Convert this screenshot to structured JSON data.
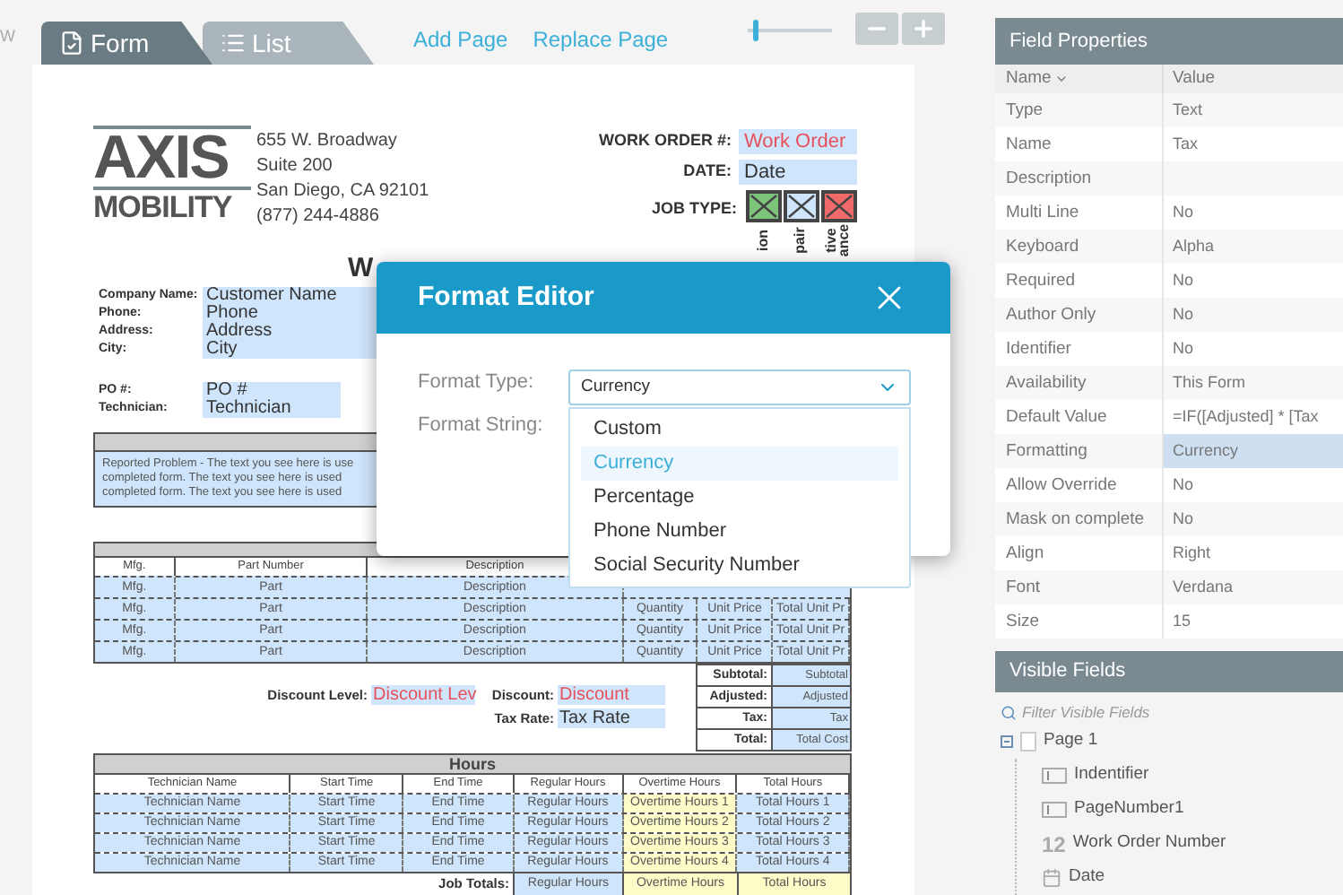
{
  "left_edge_label": "W",
  "tabs": [
    {
      "label": "Form",
      "selected": true
    },
    {
      "label": "List",
      "selected": false
    }
  ],
  "toolbar_links": [
    "Add Page",
    "Replace Page"
  ],
  "zoom": {
    "level": 0.08
  },
  "document": {
    "logo": {
      "top": "AXIS",
      "bottom": "MOBILITY"
    },
    "address": [
      "655 W. Broadway",
      "Suite 200",
      "San Diego, CA 92101",
      "(877) 244-4886"
    ],
    "header_fields": [
      {
        "label": "WORK ORDER #:",
        "value": "Work Order",
        "kind": "accent"
      },
      {
        "label": "DATE:",
        "value": "Date",
        "kind": "plain"
      }
    ],
    "job_type": {
      "label": "JOB TYPE:",
      "options": [
        {
          "checked": true,
          "color": "#7cc57a",
          "caption": [
            "ion"
          ]
        },
        {
          "checked": true,
          "color": "#cfe5fb",
          "caption": [
            "pair"
          ]
        },
        {
          "checked": true,
          "color": "#f06a6a",
          "caption": [
            "tive",
            "ance"
          ]
        }
      ]
    },
    "title": "W",
    "customer_fields": [
      {
        "label": "Company Name:",
        "value": "Customer Name"
      },
      {
        "label": "Phone:",
        "value": "Phone"
      },
      {
        "label": "Address:",
        "value": "Address"
      },
      {
        "label": "City:",
        "value": "City"
      }
    ],
    "po_fields": [
      {
        "label": "PO #:",
        "value": "PO #"
      },
      {
        "label": "Technician:",
        "value": "Technician"
      }
    ],
    "problem": {
      "lines": [
        "Reported Problem - The text you see here is use",
        "completed form. The text you see here is used",
        "completed form. The text you see here is used"
      ]
    },
    "parts": {
      "columns": [
        "Mfg.",
        "Part Number",
        "Description"
      ],
      "rows": [
        [
          "Mfg.",
          "Part",
          "Description"
        ],
        [
          "Mfg.",
          "Part",
          "Description",
          "Quantity",
          "Unit Price",
          "Total Unit Pr"
        ],
        [
          "Mfg.",
          "Part",
          "Description",
          "Quantity",
          "Unit Price",
          "Total Unit Pr"
        ],
        [
          "Mfg.",
          "Part",
          "Description",
          "Quantity",
          "Unit Price",
          "Total Unit Pr"
        ]
      ]
    },
    "discounts": [
      {
        "label": "Discount Level:",
        "value": "Discount Lev",
        "kind": "accent"
      },
      {
        "label": "Discount:",
        "value": "Discount",
        "kind": "accent"
      },
      {
        "label": "Tax Rate:",
        "value": "Tax Rate",
        "kind": "plain"
      }
    ],
    "totals": [
      {
        "label": "Subtotal:",
        "value": "Subtotal"
      },
      {
        "label": "Adjusted:",
        "value": "Adjusted"
      },
      {
        "label": "Tax:",
        "value": "Tax"
      },
      {
        "label": "Total:",
        "value": "Total Cost"
      }
    ],
    "hours": {
      "title": "Hours",
      "columns": [
        "Technician Name",
        "Start Time",
        "End Time",
        "Regular Hours",
        "Overtime Hours",
        "Total Hours"
      ],
      "rows": [
        [
          "Technician Name",
          "Start Time",
          "End Time",
          "Regular Hours",
          "Overtime Hours 1",
          "Total Hours 1"
        ],
        [
          "Technician Name",
          "Start Time",
          "End Time",
          "Regular Hours",
          "Overtime Hours 2",
          "Total Hours 2"
        ],
        [
          "Technician Name",
          "Start Time",
          "End Time",
          "Regular Hours",
          "Overtime Hours 3",
          "Total Hours 3"
        ],
        [
          "Technician Name",
          "Start Time",
          "End Time",
          "Regular Hours",
          "Overtime Hours 4",
          "Total Hours 4"
        ]
      ],
      "totals_label": "Job Totals:",
      "totals": [
        "Regular Hours",
        "Overtime Hours",
        "Total Hours"
      ]
    }
  },
  "dialog": {
    "title": "Format Editor",
    "fields": [
      {
        "label": "Format Type:"
      },
      {
        "label": "Format String:"
      }
    ],
    "select_value": "Currency",
    "options": [
      {
        "label": "Custom",
        "selected": false
      },
      {
        "label": "Currency",
        "selected": true
      },
      {
        "label": "Percentage",
        "selected": false
      },
      {
        "label": "Phone Number",
        "selected": false
      },
      {
        "label": "Social Security Number",
        "selected": false
      }
    ]
  },
  "field_properties": {
    "title": "Field Properties",
    "columns": [
      "Name",
      "Value"
    ],
    "rows": [
      {
        "name": "Type",
        "value": "Text",
        "selected": false
      },
      {
        "name": "Name",
        "value": "Tax",
        "selected": false
      },
      {
        "name": "Description",
        "selected": false
      },
      {
        "name": "Multi Line",
        "value": "No",
        "selected": false
      },
      {
        "name": "Keyboard",
        "value": "Alpha",
        "selected": false
      },
      {
        "name": "Required",
        "value": "No",
        "selected": false
      },
      {
        "name": "Author Only",
        "value": "No",
        "selected": false
      },
      {
        "name": "Identifier",
        "value": "No",
        "selected": false
      },
      {
        "name": "Availability",
        "value": "This Form",
        "selected": false
      },
      {
        "name": "Default Value",
        "value": "=IF([Adjusted] * [Tax",
        "selected": false
      },
      {
        "name": "Formatting",
        "value": "Currency",
        "selected": true
      },
      {
        "name": "Allow Override",
        "value": "No",
        "selected": false
      },
      {
        "name": "Mask on complete",
        "value": "No",
        "selected": false
      },
      {
        "name": "Align",
        "value": "Right",
        "selected": false
      },
      {
        "name": "Font",
        "value": "Verdana",
        "selected": false
      },
      {
        "name": "Size",
        "value": "15",
        "selected": false
      }
    ]
  },
  "visible_fields": {
    "title": "Visible Fields",
    "filter_placeholder": "Filter Visible Fields",
    "tree": [
      {
        "label": "Page 1",
        "kind": "page",
        "expanded": true,
        "children": [
          {
            "label": "Indentifier",
            "kind": "text"
          },
          {
            "label": "PageNumber1",
            "kind": "text"
          },
          {
            "label": "Work Order Number",
            "kind": "number",
            "badge": "12"
          },
          {
            "label": "Date",
            "kind": "date"
          }
        ]
      }
    ]
  }
}
